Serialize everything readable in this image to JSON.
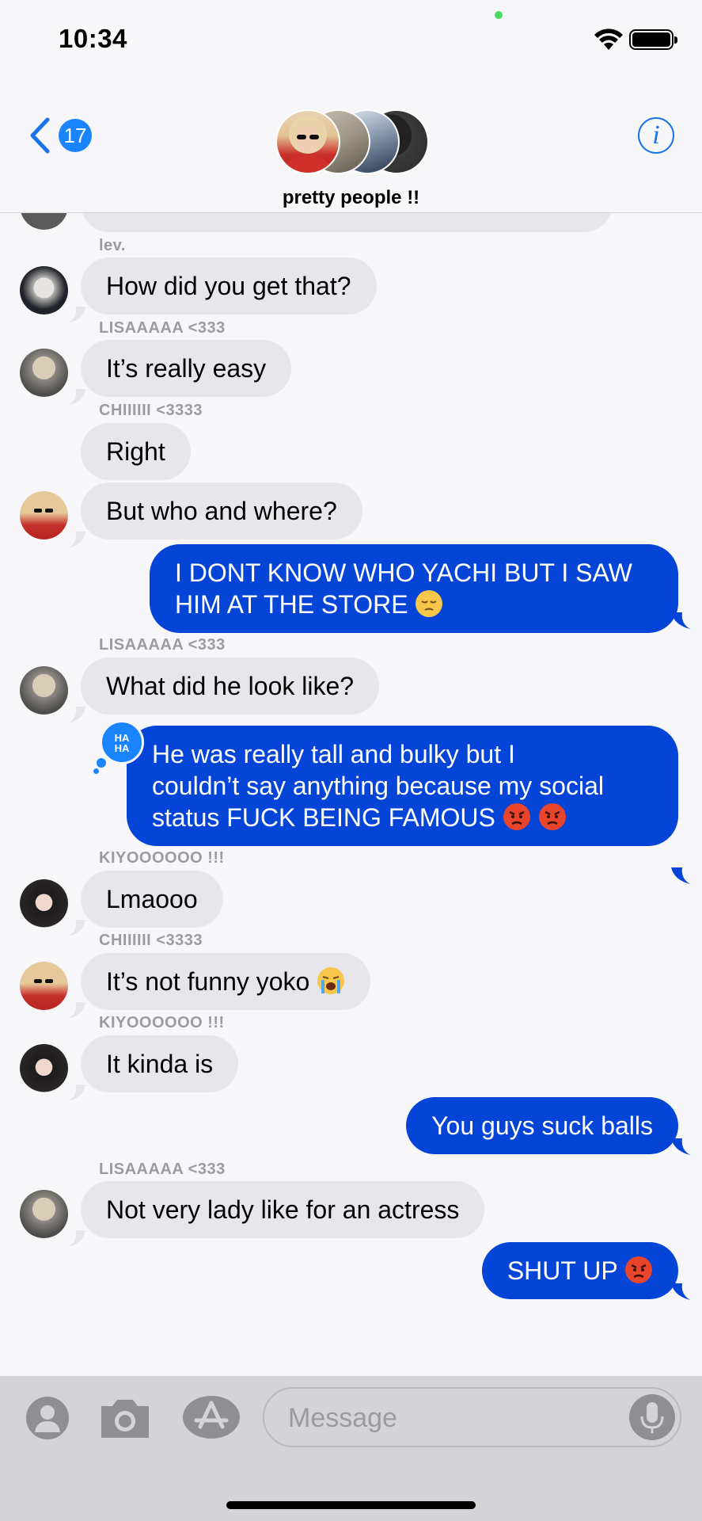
{
  "status_bar": {
    "time": "10:34"
  },
  "header": {
    "back_count": "17",
    "group_name": "pretty people !!",
    "info_label": "i"
  },
  "messages": [
    {
      "sender": "lev.",
      "text": "How did you get that?",
      "direction": "incoming"
    },
    {
      "sender": "LISAAAAA <333",
      "text": "It’s really easy",
      "direction": "incoming"
    },
    {
      "sender": "CHIIIIII <3333",
      "text": "Right",
      "direction": "incoming"
    },
    {
      "sender": "",
      "text": "But who and where?",
      "direction": "incoming"
    },
    {
      "sender": "",
      "lines": [
        "I DONT KNOW WHO YACHI BUT I SAW",
        "HIM AT THE STORE"
      ],
      "direction": "outgoing",
      "emoji": [
        "pensive-face-emoji"
      ]
    },
    {
      "sender": "LISAAAAA <333",
      "text": "What did he look like?",
      "direction": "incoming"
    },
    {
      "sender": "",
      "lines": [
        "He was really tall and bulky but I",
        "couldn’t say anything because my social",
        "status FUCK BEING FAMOUS"
      ],
      "direction": "outgoing",
      "emoji": [
        "angry-face-emoji",
        "angry-face-emoji"
      ],
      "tapback": "HA HA"
    },
    {
      "sender": "KIYOOOOOO !!!",
      "text": "Lmaooo",
      "direction": "incoming"
    },
    {
      "sender": "CHIIIIII <3333",
      "text": "It’s not funny yoko",
      "direction": "incoming",
      "emoji": [
        "crying-face-emoji"
      ]
    },
    {
      "sender": "KIYOOOOOO !!!",
      "text": "It kinda is",
      "direction": "incoming"
    },
    {
      "sender": "",
      "text": "You guys suck balls",
      "direction": "outgoing"
    },
    {
      "sender": "LISAAAAA <333",
      "text": "Not very lady like for an actress",
      "direction": "incoming"
    },
    {
      "sender": "",
      "text": "SHUT UP",
      "direction": "outgoing",
      "emoji": [
        "angry-face-emoji"
      ]
    }
  ],
  "tapback": {
    "line1": "HA",
    "line2": "HA"
  },
  "input": {
    "placeholder": "Message"
  },
  "colors": {
    "outgoing_bubble": "#0445d8",
    "incoming_bubble": "#e7e6eb",
    "accent": "#1a84ff"
  }
}
